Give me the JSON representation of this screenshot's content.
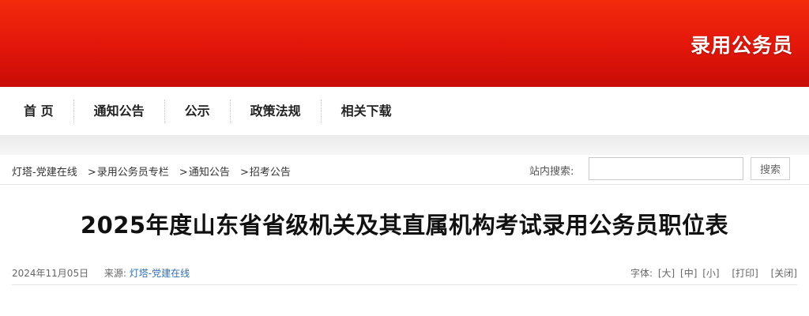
{
  "banner": {
    "title": "录用公务员"
  },
  "nav": {
    "items": [
      {
        "label": "首 页"
      },
      {
        "label": "通知公告"
      },
      {
        "label": "公示"
      },
      {
        "label": "政策法规"
      },
      {
        "label": "相关下载"
      }
    ]
  },
  "breadcrumb": {
    "items": [
      {
        "label": "灯塔-党建在线"
      },
      {
        "label": "录用公务员专栏"
      },
      {
        "label": "通知公告"
      },
      {
        "label": "招考公告"
      }
    ],
    "separator": ">"
  },
  "search": {
    "label": "站内搜索:",
    "value": "",
    "button_label": "搜索"
  },
  "article": {
    "title": "2025年度山东省省级机关及其直属机构考试录用公务员职位表",
    "date": "2024年11月05日",
    "source_label": "来源:",
    "source_name": "灯塔-党建在线",
    "font_label": "字体:",
    "font_large": "[大]",
    "font_medium": "[中]",
    "font_small": "[小]",
    "print_label": "[打印]",
    "close_label": "[关闭]"
  },
  "colors": {
    "banner_red": "#e2160a",
    "link_blue": "#2f6fb5"
  }
}
